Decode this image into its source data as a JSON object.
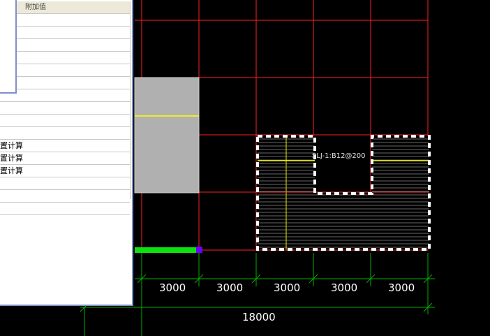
{
  "panel": {
    "header_text": "附加值",
    "rows": [
      "",
      "",
      "",
      "",
      "",
      "",
      "",
      "",
      "",
      "",
      "置计算",
      "置计算",
      "置计算",
      "",
      "",
      ""
    ]
  },
  "drawing": {
    "rebar_label": "SLJ-1:B12@200",
    "dimensions": [
      "3000",
      "3000",
      "3000",
      "3000",
      "3000"
    ],
    "total_dimension": "18000"
  },
  "colors": {
    "background": "#000000",
    "grid": "#ff0000",
    "dimension_lines": "#00c000",
    "beam_fill": "#b0b0b0",
    "axis_yellow": "#ffff00",
    "selection": "#ffffff",
    "green_bar": "#00e000",
    "grip": "#7000ff"
  }
}
